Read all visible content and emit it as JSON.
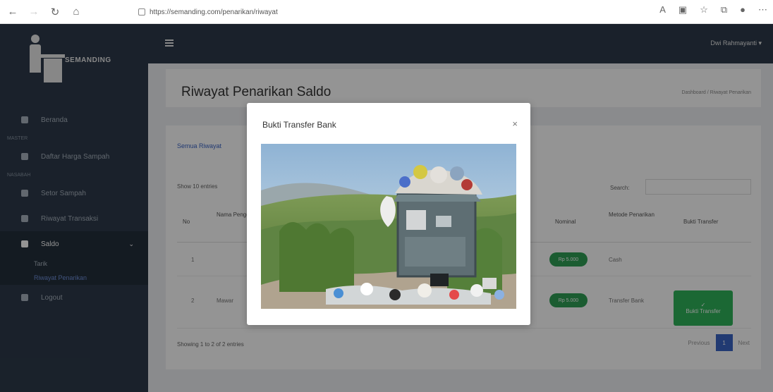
{
  "browser": {
    "url": "https://semanding.com/penarikan/riwayat"
  },
  "sidebar": {
    "brand": "SEMANDING",
    "sections": {
      "master": "MASTER",
      "nasabah": "NASABAH"
    },
    "items": [
      {
        "label": "Beranda"
      },
      {
        "label": "Daftar Harga Sampah"
      },
      {
        "label": "Setor Sampah"
      },
      {
        "label": "Riwayat Transaksi"
      },
      {
        "label": "Saldo"
      },
      {
        "label": "Logout"
      }
    ],
    "sub_items": [
      {
        "label": "Tarik"
      },
      {
        "label": "Riwayat Penarikan"
      }
    ]
  },
  "topbar": {
    "user": "Dwi Rahmayanti"
  },
  "page": {
    "title": "Riwayat Penarikan Saldo",
    "breadcrumb": "Dashboard / Riwayat Penarikan"
  },
  "table": {
    "tab_label": "Semua Riwayat",
    "show_label": "Show",
    "show_value": "10",
    "entries_label": "entries",
    "search_label": "Search:",
    "headers": [
      "No",
      "Nama Pengepul",
      "Nominal",
      "Metode Penarikan",
      "Bukti Transfer"
    ],
    "rows": [
      {
        "no": "1",
        "name": "",
        "nominal": "Rp 5.000",
        "method": "Cash"
      },
      {
        "no": "2",
        "name": "Mawar",
        "nominal": "Rp 5.000",
        "method": "Transfer Bank"
      }
    ],
    "proof_button": "Bukti Transfer",
    "footer": "Showing 1 to 2 of 2 entries",
    "pagination": {
      "prev": "Previous",
      "page": "1",
      "next": "Next"
    }
  },
  "modal": {
    "title": "Bukti Transfer Bank",
    "close_icon": "close-icon"
  },
  "colors": {
    "sidebar": "#2d3a4a",
    "primary": "#3a64c5",
    "success": "#2f9f55"
  }
}
